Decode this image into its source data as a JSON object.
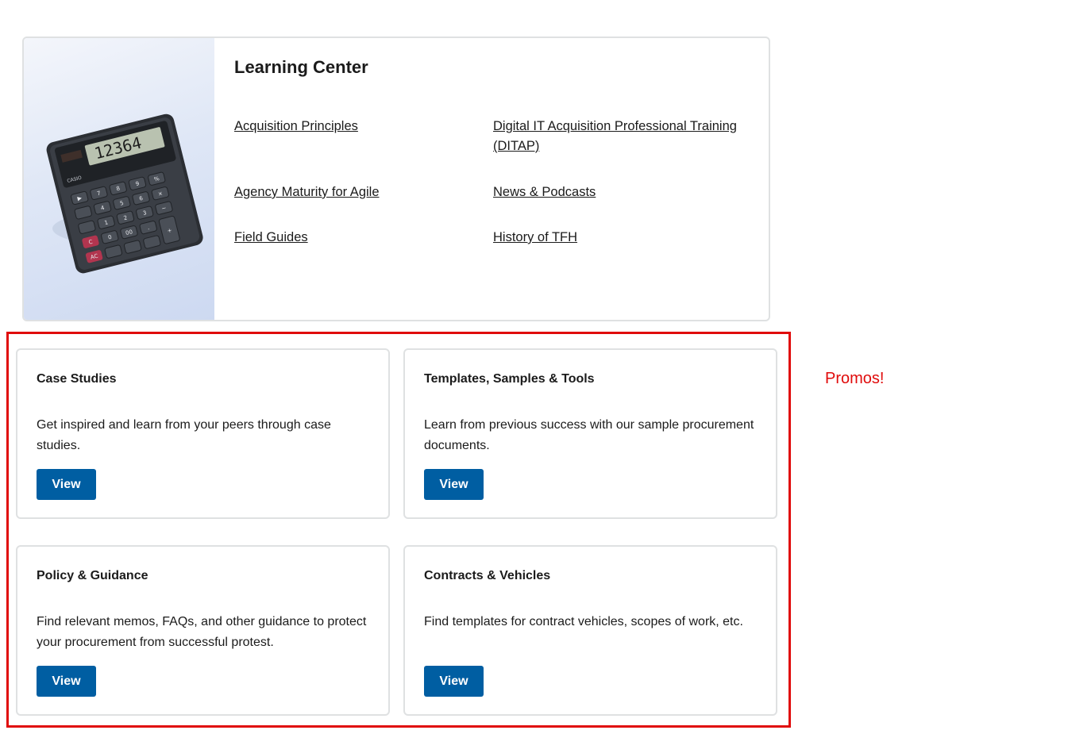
{
  "learning_center": {
    "title": "Learning Center",
    "image_icon": "calculator-image",
    "links": [
      {
        "label": "Acquisition Principles"
      },
      {
        "label": "Digital IT Acquisition Professional Training (DITAP)"
      },
      {
        "label": "Agency Maturity for Agile"
      },
      {
        "label": "News & Podcasts"
      },
      {
        "label": "Field Guides"
      },
      {
        "label": "History of TFH"
      }
    ]
  },
  "promos": {
    "annotation_label": "Promos!",
    "annotation_color": "#e00b0b",
    "button_color": "#005ea2",
    "cards": [
      {
        "title": "Case Studies",
        "description": "Get inspired and learn from your peers through case studies.",
        "button_label": "View"
      },
      {
        "title": "Templates, Samples & Tools",
        "description": "Learn from previous success with our sample procurement documents.",
        "button_label": "View"
      },
      {
        "title": "Policy & Guidance",
        "description": "Find relevant memos, FAQs, and other guidance to protect your procurement from successful protest.",
        "button_label": "View"
      },
      {
        "title": "Contracts & Vehicles",
        "description": "Find templates for contract vehicles, scopes of work, etc.",
        "button_label": "View"
      }
    ]
  }
}
